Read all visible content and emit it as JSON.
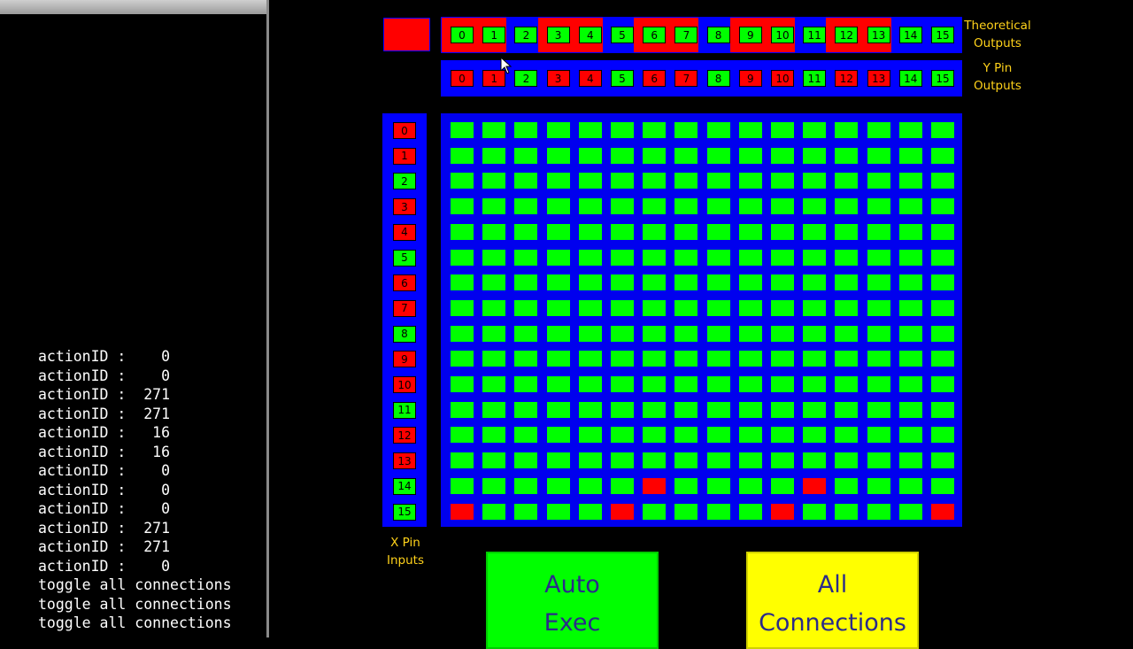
{
  "console": {
    "lines": [
      "actionID :    0",
      "actionID :    0",
      "actionID :  271",
      "actionID :  271",
      "actionID :   16",
      "actionID :   16",
      "actionID :    0",
      "actionID :    0",
      "actionID :    0",
      "actionID :  271",
      "actionID :  271",
      "actionID :    0",
      "toggle all connections",
      "toggle all connections",
      "toggle all connections"
    ]
  },
  "labels": {
    "theoretical_outputs": "Theoretical\nOutputs",
    "y_pin_outputs": "Y Pin\nOutputs",
    "x_pin_inputs": "X Pin\nInputs"
  },
  "buttons": {
    "auto_exec": "Auto\nExec",
    "all_connections": "All\nConnections"
  },
  "colors": {
    "on": "#00ff00",
    "off": "#ff0000",
    "panel": "#0000ff",
    "label": "#ffd21a",
    "auto_exec_bg": "#00ff00",
    "all_connections_bg": "#ffff00"
  },
  "indicator_state": "off",
  "theoretical_outputs": [
    {
      "n": "0",
      "s": "on"
    },
    {
      "n": "1",
      "s": "on"
    },
    {
      "n": "2",
      "s": "on"
    },
    {
      "n": "3",
      "s": "on"
    },
    {
      "n": "4",
      "s": "on"
    },
    {
      "n": "5",
      "s": "on"
    },
    {
      "n": "6",
      "s": "on"
    },
    {
      "n": "7",
      "s": "on"
    },
    {
      "n": "8",
      "s": "on"
    },
    {
      "n": "9",
      "s": "on"
    },
    {
      "n": "10",
      "s": "on"
    },
    {
      "n": "11",
      "s": "on"
    },
    {
      "n": "12",
      "s": "on"
    },
    {
      "n": "13",
      "s": "on"
    },
    {
      "n": "14",
      "s": "on"
    },
    {
      "n": "15",
      "s": "on"
    }
  ],
  "theoretical_bands": [
    "off",
    "off",
    "blue",
    "off",
    "off",
    "blue",
    "off",
    "off",
    "blue",
    "off",
    "off",
    "blue",
    "off",
    "off",
    "blue",
    "blue"
  ],
  "y_pin_outputs": [
    {
      "n": "0",
      "s": "off"
    },
    {
      "n": "1",
      "s": "off"
    },
    {
      "n": "2",
      "s": "on"
    },
    {
      "n": "3",
      "s": "off"
    },
    {
      "n": "4",
      "s": "off"
    },
    {
      "n": "5",
      "s": "on"
    },
    {
      "n": "6",
      "s": "off"
    },
    {
      "n": "7",
      "s": "off"
    },
    {
      "n": "8",
      "s": "on"
    },
    {
      "n": "9",
      "s": "off"
    },
    {
      "n": "10",
      "s": "off"
    },
    {
      "n": "11",
      "s": "on"
    },
    {
      "n": "12",
      "s": "off"
    },
    {
      "n": "13",
      "s": "off"
    },
    {
      "n": "14",
      "s": "on"
    },
    {
      "n": "15",
      "s": "on"
    }
  ],
  "x_pin_inputs": [
    {
      "n": "0",
      "s": "off"
    },
    {
      "n": "1",
      "s": "off"
    },
    {
      "n": "2",
      "s": "on"
    },
    {
      "n": "3",
      "s": "off"
    },
    {
      "n": "4",
      "s": "off"
    },
    {
      "n": "5",
      "s": "on"
    },
    {
      "n": "6",
      "s": "off"
    },
    {
      "n": "7",
      "s": "off"
    },
    {
      "n": "8",
      "s": "on"
    },
    {
      "n": "9",
      "s": "off"
    },
    {
      "n": "10",
      "s": "off"
    },
    {
      "n": "11",
      "s": "on"
    },
    {
      "n": "12",
      "s": "off"
    },
    {
      "n": "13",
      "s": "off"
    },
    {
      "n": "14",
      "s": "on"
    },
    {
      "n": "15",
      "s": "on"
    }
  ],
  "matrix_off_cells": [
    {
      "row": 14,
      "col": 6
    },
    {
      "row": 14,
      "col": 11
    },
    {
      "row": 15,
      "col": 0
    },
    {
      "row": 15,
      "col": 5
    },
    {
      "row": 15,
      "col": 10
    },
    {
      "row": 15,
      "col": 15
    }
  ]
}
